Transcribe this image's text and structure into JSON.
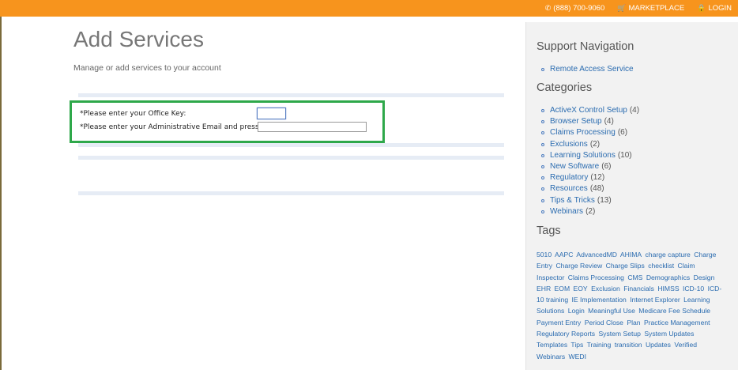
{
  "topbar": {
    "phone": "(888) 700-9060",
    "marketplace": "MARKETPLACE",
    "login": "LOGIN"
  },
  "page": {
    "title": "Add Services",
    "subtitle": "Manage or add services to your account"
  },
  "form": {
    "office_key_label": "*Please enter your Office Key:",
    "office_key_value": "",
    "admin_email_label": "*Please enter your Administrative Email and press Tab:",
    "admin_email_value": ""
  },
  "sidebar": {
    "support_heading": "Support Navigation",
    "support_items": [
      {
        "label": "Remote Access Service"
      }
    ],
    "categories_heading": "Categories",
    "categories": [
      {
        "label": "ActiveX Control Setup",
        "count": "(4)"
      },
      {
        "label": "Browser Setup",
        "count": "(4)"
      },
      {
        "label": "Claims Processing",
        "count": "(6)"
      },
      {
        "label": "Exclusions",
        "count": "(2)"
      },
      {
        "label": "Learning Solutions",
        "count": "(10)"
      },
      {
        "label": "New Software",
        "count": "(6)"
      },
      {
        "label": "Regulatory",
        "count": "(12)"
      },
      {
        "label": "Resources",
        "count": "(48)"
      },
      {
        "label": "Tips & Tricks",
        "count": "(13)"
      },
      {
        "label": "Webinars",
        "count": "(2)"
      }
    ],
    "tags_heading": "Tags",
    "tags": [
      "5010",
      "AAPC",
      "AdvancedMD",
      "AHIMA",
      "charge capture",
      "Charge Entry",
      "Charge Review",
      "Charge Slips",
      "checklist",
      "Claim Inspector",
      "Claims Processing",
      "CMS",
      "Demographics",
      "Design",
      "EHR",
      "EOM",
      "EOY",
      "Exclusion",
      "Financials",
      "HIMSS",
      "ICD-10",
      "ICD-10 training",
      "IE Implementation",
      "Internet Explorer",
      "Learning Solutions",
      "Login",
      "Meaningful Use",
      "Medicare Fee Schedule",
      "Payment Entry",
      "Period Close",
      "Plan",
      "Practice Management",
      "Regulatory Reports",
      "System Setup",
      "System Updates",
      "Templates",
      "Tips",
      "Training",
      "transition",
      "Updates",
      "Verified",
      "Webinars",
      "WEDI"
    ]
  },
  "colors": {
    "topbar": "#f7941d",
    "highlight": "#2ea84a",
    "link": "#2b6cb0"
  }
}
